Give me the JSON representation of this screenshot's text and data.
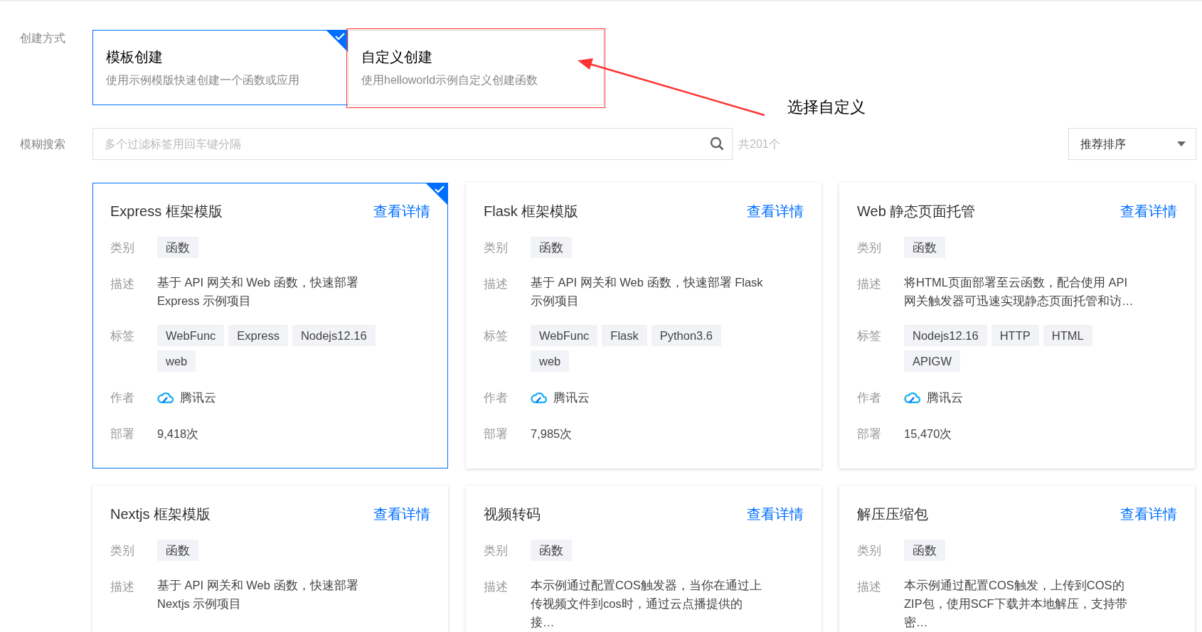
{
  "create_method": {
    "label": "创建方式",
    "options": [
      {
        "title": "模板创建",
        "subtitle": "使用示例模版快速创建一个函数或应用",
        "selected": true,
        "annotated": false
      },
      {
        "title": "自定义创建",
        "subtitle": "使用helloworld示例自定义创建函数",
        "selected": false,
        "annotated": true
      }
    ]
  },
  "annotation": {
    "text": "选择自定义"
  },
  "search": {
    "label": "模糊搜索",
    "placeholder": "多个过滤标签用回车键分隔",
    "count": "共201个",
    "sort": "推荐排序"
  },
  "cards": [
    {
      "title": "Express 框架模版",
      "link": "查看详情",
      "selected": true,
      "category_label": "类别",
      "category": "函数",
      "desc_label": "描述",
      "desc": "基于 API 网关和 Web 函数，快速部署 Express 示例项目",
      "tags_label": "标签",
      "tags": [
        "WebFunc",
        "Express",
        "Nodejs12.16",
        "web"
      ],
      "author_label": "作者",
      "author": "腾讯云",
      "deploy_label": "部署",
      "deploys": "9,418次"
    },
    {
      "title": "Flask 框架模版",
      "link": "查看详情",
      "selected": false,
      "category_label": "类别",
      "category": "函数",
      "desc_label": "描述",
      "desc": "基于 API 网关和 Web 函数，快速部署 Flask 示例项目",
      "tags_label": "标签",
      "tags": [
        "WebFunc",
        "Flask",
        "Python3.6",
        "web"
      ],
      "author_label": "作者",
      "author": "腾讯云",
      "deploy_label": "部署",
      "deploys": "7,985次"
    },
    {
      "title": "Web 静态页面托管",
      "link": "查看详情",
      "selected": false,
      "category_label": "类别",
      "category": "函数",
      "desc_label": "描述",
      "desc": "将HTML页面部署至云函数，配合使用 API 网关触发器可迅速实现静态页面托管和访…",
      "tags_label": "标签",
      "tags": [
        "Nodejs12.16",
        "HTTP",
        "HTML",
        "APIGW"
      ],
      "author_label": "作者",
      "author": "腾讯云",
      "deploy_label": "部署",
      "deploys": "15,470次"
    },
    {
      "title": "Nextjs 框架模版",
      "link": "查看详情",
      "selected": false,
      "category_label": "类别",
      "category": "函数",
      "desc_label": "描述",
      "desc": "基于 API 网关和 Web 函数，快速部署 Nextjs 示例项目"
    },
    {
      "title": "视频转码",
      "link": "查看详情",
      "selected": false,
      "category_label": "类别",
      "category": "函数",
      "desc_label": "描述",
      "desc": "本示例通过配置COS触发器，当你在通过上传视频文件到cos时，通过云点播提供的接…"
    },
    {
      "title": "解压压缩包",
      "link": "查看详情",
      "selected": false,
      "category_label": "类别",
      "category": "函数",
      "desc_label": "描述",
      "desc": "本示例通过配置COS触发，上传到COS的ZIP包，使用SCF下载并本地解压，支持带密…"
    }
  ]
}
